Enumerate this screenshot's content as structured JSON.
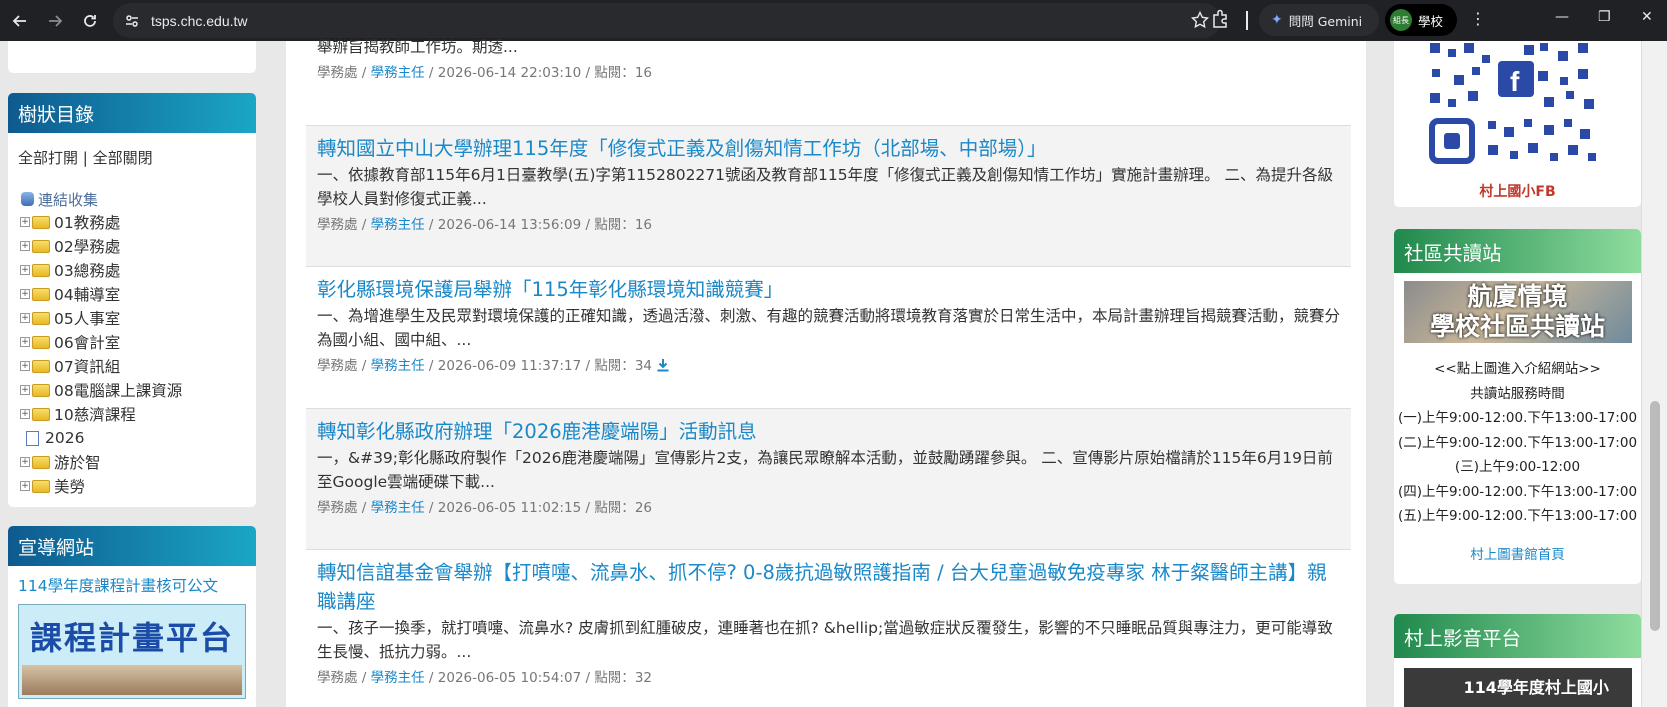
{
  "browser": {
    "url": "tsps.chc.edu.tw",
    "gemini_label": "問問 Gemini",
    "profile_badge": "組長",
    "profile_label": "學校"
  },
  "tree": {
    "title": "樹狀目錄",
    "open_all": "全部打開",
    "divider": "|",
    "close_all": "全部關閉",
    "root": "連結收集",
    "folders": [
      "01教務處",
      "02學務處",
      "03總務處",
      "04輔導室",
      "05人事室",
      "06會計室",
      "07資訊組",
      "08電腦課上課資源",
      "10慈濟課程"
    ],
    "doc": "2026",
    "folders2": [
      "游於智",
      "美勞"
    ]
  },
  "promo": {
    "title": "宣導網站",
    "link": "114學年度課程計畫核可公文",
    "banner_text": "課程計畫平台"
  },
  "news": [
    {
      "title": "",
      "desc": "舉辦旨揭教師工作坊。期透...",
      "dept": "學務處",
      "poster": "學務主任",
      "date": "2026-06-14 22:03:10",
      "hits_label": "點閱：",
      "hits": "16"
    },
    {
      "title": "轉知國立中山大學辦理115年度「修復式正義及創傷知情工作坊（北部場、中部場）」",
      "desc": "一、依據教育部115年6月1日臺教學(五)字第1152802271號函及教育部115年度「修復式正義及創傷知情工作坊」實施計畫辦理。 二、為提升各級學校人員對修復式正義...",
      "dept": "學務處",
      "poster": "學務主任",
      "date": "2026-06-14 13:56:09",
      "hits_label": "點閱：",
      "hits": "16"
    },
    {
      "title": "彰化縣環境保護局舉辦「115年彰化縣環境知識競賽」",
      "desc": "一、為增進學生及民眾對環境保護的正確知識，透過活潑、刺激、有趣的競賽活動將環境教育落實於日常生活中，本局計畫辦理旨揭競賽活動，競賽分為國小組、國中組、...",
      "dept": "學務處",
      "poster": "學務主任",
      "date": "2026-06-09 11:37:17",
      "hits_label": "點閱：",
      "hits": "34"
    },
    {
      "title": "轉知彰化縣政府辦理「2026鹿港慶端陽」活動訊息",
      "desc": "一，&#39;彰化縣政府製作「2026鹿港慶端陽」宣傳影片2支，為讓民眾瞭解本活動，並鼓勵踴躍參與。 二、宣傳影片原始檔請於115年6月19日前至Google雲端硬碟下載...",
      "dept": "學務處",
      "poster": "學務主任",
      "date": "2026-06-05 11:02:15",
      "hits_label": "點閱：",
      "hits": "26"
    },
    {
      "title": "轉知信誼基金會舉辦【打噴嚏、流鼻水、抓不停? 0-8歲抗過敏照護指南 / 台大兒童過敏免疫專家 林于粲醫師主講】親職講座",
      "desc": "一、孩子一換季，就打噴嚏、流鼻水? 皮膚抓到紅腫破皮，連睡著也在抓? &hellip;當過敏症狀反覆發生，影響的不只睡眠品質與專注力，更可能導致生長慢、抵抗力弱。...",
      "dept": "學務處",
      "poster": "學務主任",
      "date": "2026-06-05 10:54:07",
      "hits_label": "點閱：",
      "hits": "32"
    }
  ],
  "qr": {
    "caption": "村上國小FB"
  },
  "community": {
    "title": "社區共讀站",
    "banner_line1": "航廈情境",
    "banner_line2": "學校社區共讀站",
    "lines": [
      "<<點上圖進入介紹網站>>",
      "共讀站服務時間",
      "(一)上午9:00-12:00.下午13:00-17:00",
      "(二)上午9:00-12:00.下午13:00-17:00",
      "(三)上午9:00-12:00",
      "(四)上午9:00-12:00.下午13:00-17:00",
      "(五)上午9:00-12:00.下午13:00-17:00"
    ],
    "link": "村上圖書館首頁"
  },
  "video": {
    "title": "村上影音平台",
    "thumb_text": "114學年度村上國小"
  },
  "colors": {
    "accent": "#1a88c9",
    "tree_head": "#0e5a8f",
    "right_head": "#20894d"
  }
}
